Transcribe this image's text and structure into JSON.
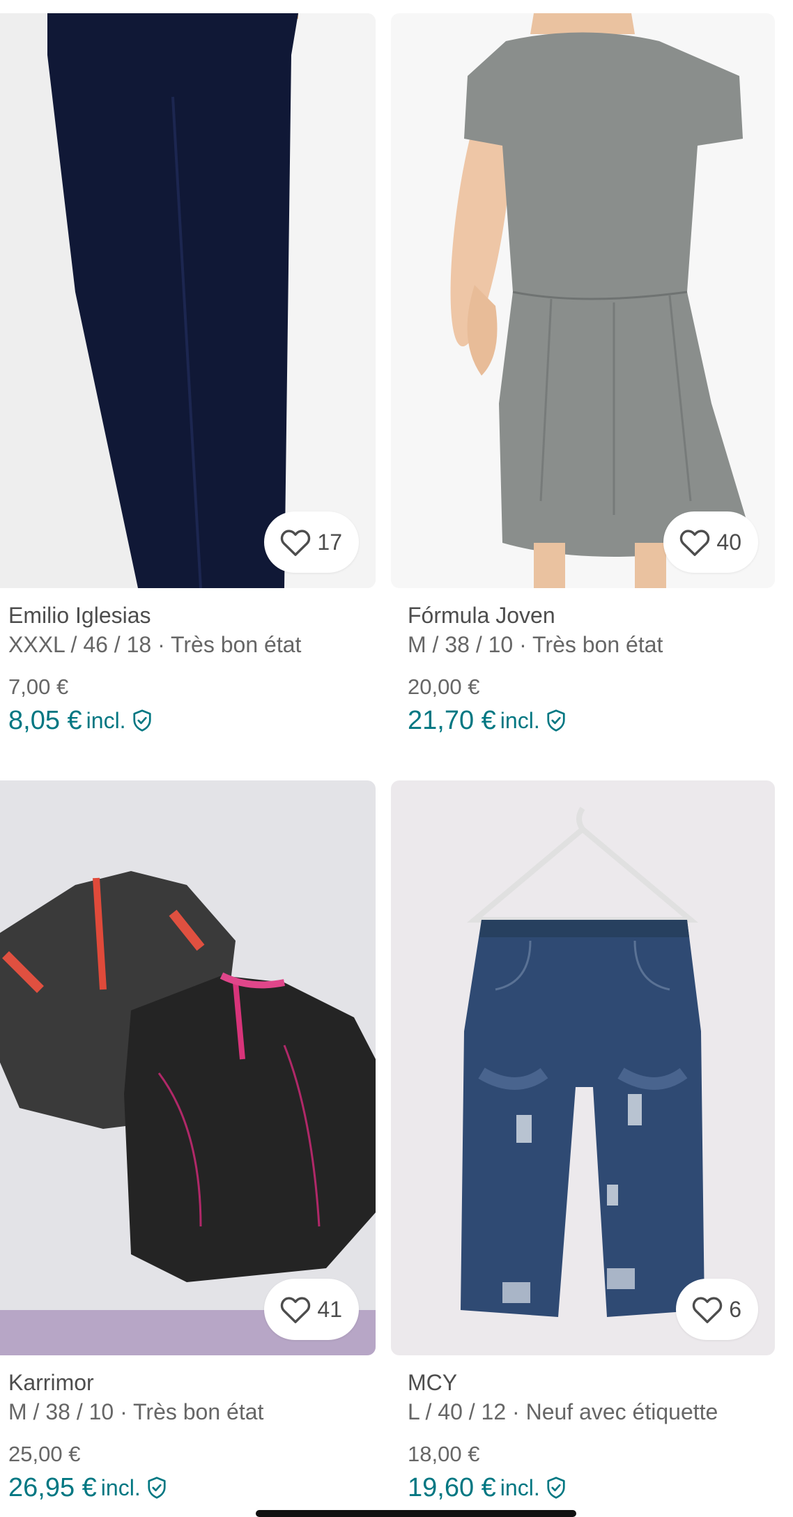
{
  "colors": {
    "accent": "#007782",
    "text_primary": "#4d4d4d",
    "text_secondary": "#666666",
    "photo_bg": "#f3f3f3"
  },
  "items": [
    {
      "brand": "Emilio Iglesias",
      "details": "XXXL / 46 / 18 · Très bon état",
      "price": "7,00 €",
      "price_incl": "8,05 €",
      "incl_label": "incl.",
      "favorites": "17",
      "photo": "navy-trousers-photo"
    },
    {
      "brand": "Fórmula Joven",
      "details": "M / 38 / 10 · Très bon état",
      "price": "20,00 €",
      "price_incl": "21,70 €",
      "incl_label": "incl.",
      "favorites": "40",
      "photo": "grey-dress-photo"
    },
    {
      "brand": "Karrimor",
      "details": "M / 38 / 10 · Très bon état",
      "price": "25,00 €",
      "price_incl": "26,95 €",
      "incl_label": "incl.",
      "favorites": "41",
      "photo": "sport-jackets-photo"
    },
    {
      "brand": "MCY",
      "details": "L / 40 / 12 · Neuf avec étiquette",
      "price": "18,00 €",
      "price_incl": "19,60 €",
      "incl_label": "incl.",
      "favorites": "6",
      "photo": "ripped-jeans-photo"
    }
  ],
  "icons": {
    "favorite": "heart-icon",
    "buyer_protection": "shield-check-icon"
  }
}
